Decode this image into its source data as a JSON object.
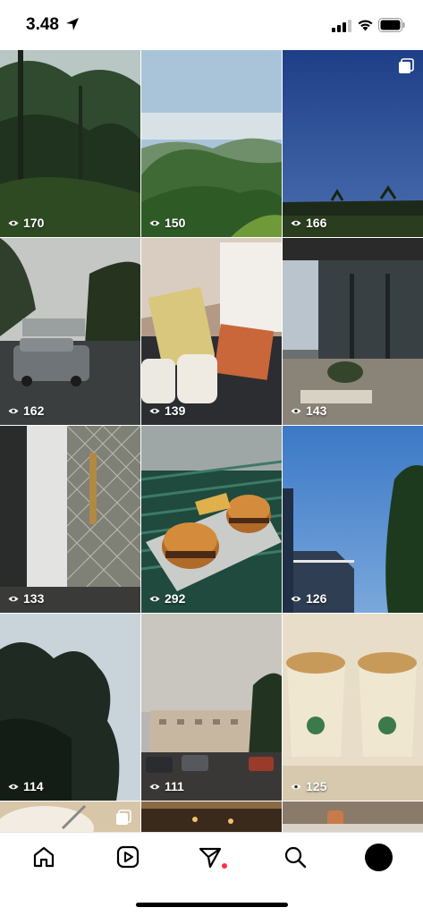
{
  "status_bar": {
    "time": "3.48"
  },
  "grid": {
    "tiles": [
      {
        "views": "170",
        "scene": "tropical-forest-trees"
      },
      {
        "views": "150",
        "scene": "green-mountains-sky"
      },
      {
        "views": "166",
        "scene": "blue-dusk-sky-palm-trees",
        "multi": true
      },
      {
        "views": "162",
        "scene": "rainy-street-car"
      },
      {
        "views": "139",
        "scene": "food-bag-drinks-on-table"
      },
      {
        "views": "143",
        "scene": "cafe-exterior-glass"
      },
      {
        "views": "133",
        "scene": "interior-window-grille"
      },
      {
        "views": "292",
        "scene": "burgers-on-tray"
      },
      {
        "views": "126",
        "scene": "blue-sky-building-tree"
      },
      {
        "views": "114",
        "scene": "trees-pale-sky"
      },
      {
        "views": "111",
        "scene": "parking-lot-building-sunset"
      },
      {
        "views": "125",
        "scene": "two-iced-drinks"
      }
    ]
  },
  "tabbar": {
    "items": [
      "home",
      "reels",
      "direct",
      "search",
      "profile"
    ]
  }
}
